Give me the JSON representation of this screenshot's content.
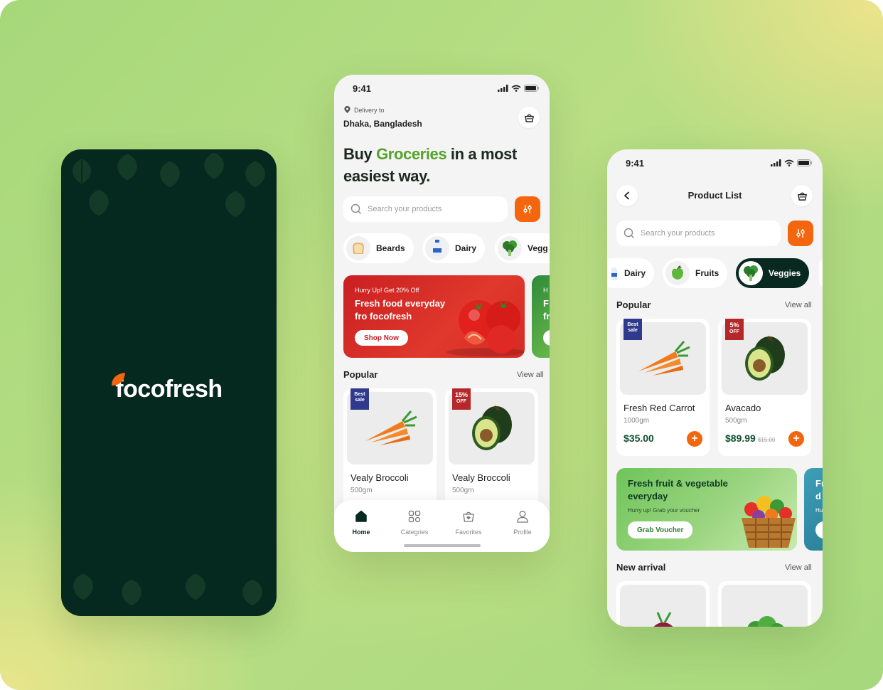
{
  "colors": {
    "accent_orange": "#f3660d",
    "dark_green": "#08291f",
    "brand_green": "#55a32a",
    "price_green": "#0f5132"
  },
  "splash": {
    "logo_text": "focofresh"
  },
  "home": {
    "time": "9:41",
    "delivery_label": "Delivery to",
    "delivery_location": "Dhaka, Bangladesh",
    "headline_pre": "Buy ",
    "headline_highlight": "Groceries",
    "headline_post": " in a most easiest way.",
    "search_placeholder": "Search your products",
    "categories": [
      {
        "label": "Beards",
        "icon": "bread-icon"
      },
      {
        "label": "Dairy",
        "icon": "milk-bottle-icon"
      },
      {
        "label": "Vegg",
        "icon": "broccoli-icon"
      }
    ],
    "banner": {
      "promo": "Hurry Up! Get 20%  Off",
      "title_line1": "Fresh food everyday",
      "title_line2": "fro focofresh",
      "button": "Shop Now",
      "peek_line1": "H",
      "peek_line2": "F",
      "peek_line3": "fr"
    },
    "popular_title": "Popular",
    "view_all": "View all",
    "products": [
      {
        "badge_line1": "Best",
        "badge_line2": "sale",
        "name": "Vealy Broccoli",
        "weight": "500gm"
      },
      {
        "badge_line1": "15%",
        "badge_line2": "OFF",
        "name": "Vealy Broccoli",
        "weight": "500gm"
      }
    ],
    "nav": [
      {
        "label": "Home",
        "icon": "home-icon"
      },
      {
        "label": "Categries",
        "icon": "grid-icon"
      },
      {
        "label": "Favorites",
        "icon": "heart-bag-icon"
      },
      {
        "label": "Profile",
        "icon": "user-icon"
      }
    ]
  },
  "list": {
    "time": "9:41",
    "title": "Product List",
    "search_placeholder": "Search your products",
    "categories": [
      {
        "label": "Dairy",
        "icon": "milk-bottle-icon"
      },
      {
        "label": "Fruits",
        "icon": "apple-icon"
      },
      {
        "label": "Veggies",
        "icon": "broccoli-icon",
        "active": true
      }
    ],
    "popular_title": "Popular",
    "view_all": "View all",
    "products": [
      {
        "badge_line1": "Best",
        "badge_line2": "sale",
        "name": "Fresh Red Carrot",
        "weight": "1000gm",
        "price": "$35.00",
        "old_price": ""
      },
      {
        "badge_line1": "5%",
        "badge_line2": "OFF",
        "name": "Avacado",
        "weight": "500gm",
        "price": "$89.99",
        "old_price": "$15.00"
      }
    ],
    "banner": {
      "title_line1": "Fresh fruit & vegetable",
      "title_line2": "everyday",
      "subtitle": "Hurry up! Grab your voucher",
      "button": "Grab Voucher",
      "peek_line1": "Fr",
      "peek_line2": "d",
      "peek_line3": "Hu"
    },
    "new_arrival_title": "New arrival",
    "new_arrival_view_all": "View all"
  }
}
